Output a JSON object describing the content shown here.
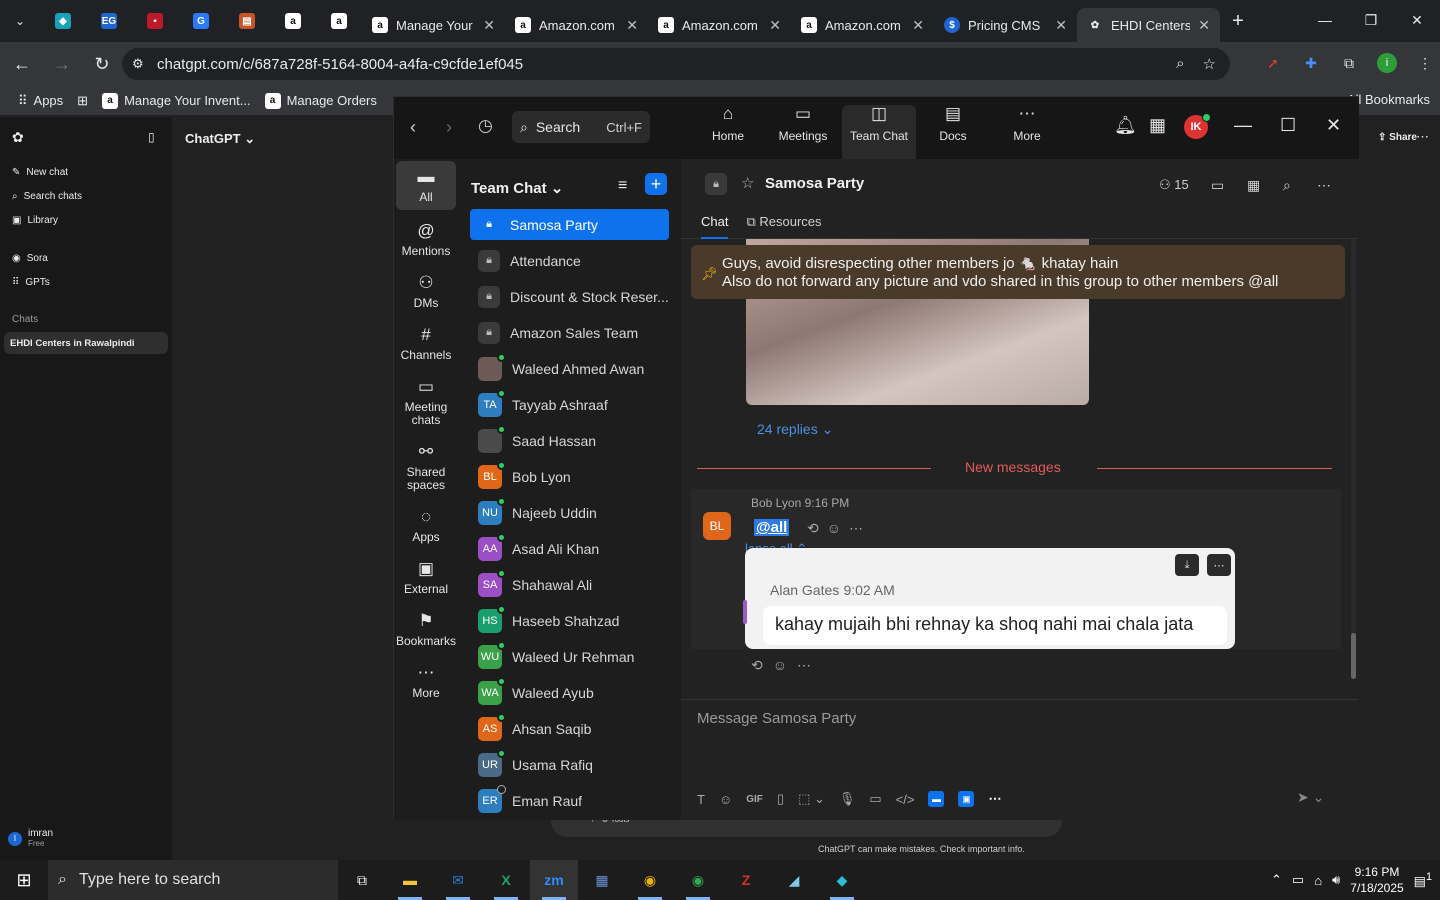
{
  "browser": {
    "tabs": [
      {
        "title": "Manage Your",
        "favicon": "amazon-icon"
      },
      {
        "title": "Amazon.com",
        "favicon": "amazon-icon"
      },
      {
        "title": "Amazon.com",
        "favicon": "amazon-icon"
      },
      {
        "title": "Amazon.com",
        "favicon": "amazon-icon"
      },
      {
        "title": "Pricing CMS",
        "favicon": "dollar-icon"
      },
      {
        "title": "EHDI Centers",
        "favicon": "chatgpt-icon"
      }
    ],
    "url": "chatgpt.com/c/687a728f-5164-8004-a4fa-c9cfde1ef045",
    "bookmarks": [
      "Apps",
      "Manage Your Invent...",
      "Manage Orders"
    ],
    "all_bookmarks": "All Bookmarks"
  },
  "chatgpt": {
    "model": "ChatGPT",
    "new_chat": "New chat",
    "search_chats": "Search chats",
    "library": "Library",
    "sora": "Sora",
    "gpts": "GPTs",
    "chats_label": "Chats",
    "active_chat": "EHDI Centers in Rawalpindi",
    "share": "Share",
    "user_name": "imran",
    "user_plan": "Free",
    "user_initial": "I",
    "disclaimer": "ChatGPT can make mistakes. Check important info.",
    "tools": "Tools"
  },
  "zoom": {
    "search_placeholder": "Search",
    "search_shortcut": "Ctrl+F",
    "top_tabs": [
      "Home",
      "Meetings",
      "Team Chat",
      "Docs",
      "More"
    ],
    "avatar_initials": "IK",
    "rail": [
      "All",
      "Mentions",
      "DMs",
      "Channels",
      "Meeting chats",
      "Shared spaces",
      "Apps",
      "External",
      "Bookmarks",
      "More"
    ],
    "list_title": "Team Chat",
    "channels": [
      {
        "name": "Samosa Party",
        "kind": "lock"
      },
      {
        "name": "Attendance",
        "kind": "lock"
      },
      {
        "name": "Discount & Stock Reser...",
        "kind": "lock"
      },
      {
        "name": "Amazon Sales Team",
        "kind": "lock"
      },
      {
        "name": "Waleed Ahmed Awan",
        "kind": "photo",
        "color": "#6b5a55",
        "initials": "",
        "status": "online"
      },
      {
        "name": "Tayyab Ashraaf",
        "kind": "avatar",
        "color": "#2d7dbf",
        "initials": "TA",
        "status": "online"
      },
      {
        "name": "Saad Hassan",
        "kind": "photo",
        "color": "#4a4a4a",
        "initials": "",
        "status": "online"
      },
      {
        "name": "Bob Lyon",
        "kind": "avatar",
        "color": "#e0661a",
        "initials": "BL",
        "status": "online"
      },
      {
        "name": "Najeeb Uddin",
        "kind": "avatar",
        "color": "#2d7dbf",
        "initials": "NU",
        "status": "online"
      },
      {
        "name": "Asad Ali Khan",
        "kind": "avatar",
        "color": "#9b4fc4",
        "initials": "AA",
        "status": "online"
      },
      {
        "name": "Shahawal Ali",
        "kind": "avatar",
        "color": "#9b4fc4",
        "initials": "SA",
        "status": "online"
      },
      {
        "name": "Haseeb Shahzad",
        "kind": "avatar",
        "color": "#1a9e6e",
        "initials": "HS",
        "status": "online"
      },
      {
        "name": "Waleed Ur Rehman",
        "kind": "avatar",
        "color": "#3aa04a",
        "initials": "WU",
        "status": "online"
      },
      {
        "name": "Waleed Ayub",
        "kind": "avatar",
        "color": "#3aa04a",
        "initials": "WA",
        "status": "online"
      },
      {
        "name": "Ahsan Saqib",
        "kind": "avatar",
        "color": "#e0661a",
        "initials": "AS",
        "status": "online"
      },
      {
        "name": "Usama Rafiq",
        "kind": "avatar",
        "color": "#4b6a88",
        "initials": "UR",
        "status": "online"
      },
      {
        "name": "Eman Rauf",
        "kind": "avatar",
        "color": "#2d7dbf",
        "initials": "ER",
        "status": "offline"
      }
    ],
    "chat": {
      "title": "Samosa Party",
      "member_count": "15",
      "tabs": [
        "Chat",
        "Resources"
      ],
      "pinned_line1": "Guys, avoid disrespecting other members jo 🐁 khatay hain",
      "pinned_line2": "Also do not forward any picture and vdo shared in this group to other members @all",
      "replies": "24 replies",
      "new_messages": "New messages",
      "message_meta": "Bob Lyon 9:16 PM",
      "message_avatar": "BL",
      "message_text": "@all",
      "ghost_text": "lapse all",
      "quoted_author": "Alan Gates",
      "quoted_time": "9:02 AM",
      "quoted_text": "kahay mujaih bhi rehnay ka shoq nahi mai chala jata",
      "composer_placeholder": "Message Samosa Party"
    }
  },
  "taskbar": {
    "search_placeholder": "Type here to search",
    "time": "9:16 PM",
    "date": "7/18/2025",
    "notification_count": "1"
  },
  "colors": {
    "zoom_blue": "#0e72ed",
    "pinned_bg": "#4a3a29",
    "new_messages": "#e05c5c"
  }
}
